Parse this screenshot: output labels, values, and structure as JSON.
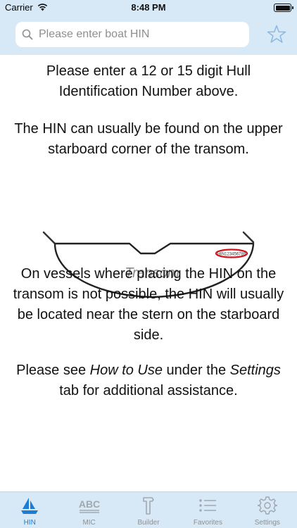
{
  "status": {
    "carrier": "Carrier",
    "time": "8:48 PM"
  },
  "search": {
    "placeholder": "Please enter boat HIN"
  },
  "content": {
    "para1": "Please enter a 12 or 15 digit Hull Identification Number above.",
    "para2": "The HIN can usually be found on the upper starboard corner of the transom.",
    "diagram_label": "Transom",
    "para3": "On vessels where placing the HIN on the transom is not possible, the HIN will usually be located near the stern on the starboard side.",
    "para4_pre": "Please see ",
    "para4_how": "How to Use",
    "para4_mid": " under the ",
    "para4_settings": "Settings",
    "para4_post": " tab for additional assistance."
  },
  "tabs": [
    {
      "label": "HIN",
      "icon": "sailboat-icon",
      "active": true
    },
    {
      "label": "MIC",
      "icon": "abc-icon"
    },
    {
      "label": "Builder",
      "icon": "hammer-icon"
    },
    {
      "label": "Favorites",
      "icon": "list-icon"
    },
    {
      "label": "Settings",
      "icon": "gear-icon"
    }
  ],
  "colors": {
    "accent": "#1c7cd6",
    "header": "#d7e9f7",
    "inactive": "#8e8e93",
    "hin_marker": "#d0121b"
  }
}
